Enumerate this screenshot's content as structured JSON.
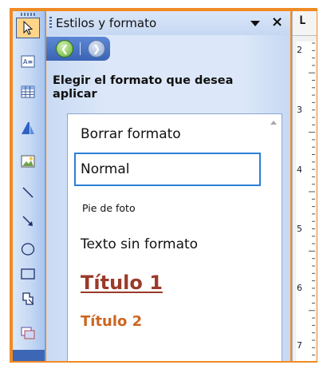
{
  "task_pane": {
    "title": "Estilos y formato",
    "nav": {
      "back_icon": "back-arrow-icon",
      "forward_icon": "forward-arrow-icon"
    },
    "prompt": "Elegir el formato que desea aplicar",
    "styles": [
      {
        "label": "Borrar formato",
        "selected": false
      },
      {
        "label": "Normal",
        "selected": true
      },
      {
        "label": "Pie de foto",
        "selected": false
      },
      {
        "label": "Texto sin formato",
        "selected": false
      },
      {
        "label": "Título 1",
        "selected": false,
        "color": "#9b3a2a"
      },
      {
        "label": "Título 2",
        "selected": false,
        "color": "#cc6622"
      }
    ]
  },
  "drawing_toolbar": {
    "tools": [
      "select-objects-icon",
      "text-box-icon",
      "table-icon",
      "wordart-icon",
      "picture-icon",
      "line-icon",
      "arrow-icon",
      "oval-icon",
      "rectangle-icon",
      "shape-icon",
      "insert-object-icon"
    ]
  },
  "ruler": {
    "numbers": [
      "2",
      "3",
      "4",
      "5",
      "6",
      "7"
    ]
  },
  "colors": {
    "frame": "#f08a24",
    "pane": "#dce8f9",
    "selection": "#2b7fd8"
  }
}
